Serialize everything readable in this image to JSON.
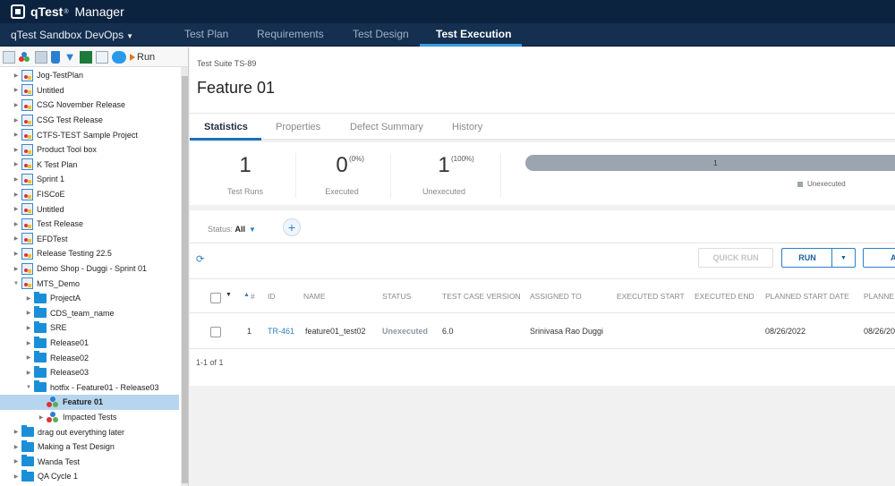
{
  "header": {
    "brand": "qTest",
    "brand_sup": "®",
    "app_name": "Manager"
  },
  "nav": {
    "project": "qTest Sandbox DevOps",
    "tabs": [
      {
        "label": "Test Plan",
        "active": false
      },
      {
        "label": "Requirements",
        "active": false
      },
      {
        "label": "Test Design",
        "active": false
      },
      {
        "label": "Test Execution",
        "active": true
      }
    ]
  },
  "sidebar": {
    "toolbar": {
      "icons": [
        "release-icon",
        "new-suite-icon",
        "new-module-icon",
        "delete-icon",
        "filter-icon",
        "export-excel-icon",
        "import-icon",
        "toggle-icon"
      ],
      "run_label": "Run"
    },
    "tree": [
      {
        "label": "Jog-TestPlan",
        "type": "plan",
        "level": 1,
        "expand": "closed"
      },
      {
        "label": "Untitled",
        "type": "plan",
        "level": 1,
        "expand": "closed"
      },
      {
        "label": "CSG November Release",
        "type": "plan",
        "level": 1,
        "expand": "closed"
      },
      {
        "label": "CSG Test Release",
        "type": "plan",
        "level": 1,
        "expand": "closed"
      },
      {
        "label": "CTFS-TEST Sample Project",
        "type": "plan",
        "level": 1,
        "expand": "closed"
      },
      {
        "label": "Product Tool box",
        "type": "plan",
        "level": 1,
        "expand": "closed"
      },
      {
        "label": "K Test Plan",
        "type": "plan",
        "level": 1,
        "expand": "closed"
      },
      {
        "label": "Sprint 1",
        "type": "plan",
        "level": 1,
        "expand": "closed"
      },
      {
        "label": "FISCoE",
        "type": "plan",
        "level": 1,
        "expand": "closed"
      },
      {
        "label": "Untitled",
        "type": "plan",
        "level": 1,
        "expand": "closed"
      },
      {
        "label": "Test Release",
        "type": "plan",
        "level": 1,
        "expand": "closed"
      },
      {
        "label": "EFDTest",
        "type": "plan",
        "level": 1,
        "expand": "closed"
      },
      {
        "label": "Release Testing 22.5",
        "type": "plan",
        "level": 1,
        "expand": "closed"
      },
      {
        "label": "Demo Shop - Duggi - Sprint 01",
        "type": "plan",
        "level": 1,
        "expand": "closed"
      },
      {
        "label": "MTS_Demo",
        "type": "plan",
        "level": 1,
        "expand": "open"
      },
      {
        "label": "ProjectA",
        "type": "folder",
        "level": 2,
        "expand": "closed"
      },
      {
        "label": "CDS_team_name",
        "type": "folder",
        "level": 2,
        "expand": "closed"
      },
      {
        "label": "SRE",
        "type": "folder",
        "level": 2,
        "expand": "closed"
      },
      {
        "label": "Release01",
        "type": "folder",
        "level": 2,
        "expand": "closed"
      },
      {
        "label": "Release02",
        "type": "folder",
        "level": 2,
        "expand": "closed"
      },
      {
        "label": "Release03",
        "type": "folder",
        "level": 2,
        "expand": "closed"
      },
      {
        "label": "hotfix - Feature01 - Release03",
        "type": "folder",
        "level": 2,
        "expand": "open"
      },
      {
        "label": "Feature 01",
        "type": "suite",
        "level": 3,
        "expand": "none",
        "selected": true
      },
      {
        "label": "Impacted Tests",
        "type": "suite",
        "level": 3,
        "expand": "closed"
      },
      {
        "label": "drag out everything later",
        "type": "folder",
        "level": 1,
        "expand": "closed"
      },
      {
        "label": "Making a Test Design",
        "type": "folder",
        "level": 1,
        "expand": "closed"
      },
      {
        "label": "Wanda Test",
        "type": "folder",
        "level": 1,
        "expand": "closed"
      },
      {
        "label": "QA Cycle 1",
        "type": "folder",
        "level": 1,
        "expand": "closed"
      }
    ]
  },
  "main": {
    "suite_label": "Test Suite TS-89",
    "title": "Feature 01",
    "tabs": [
      {
        "label": "Statistics",
        "active": true
      },
      {
        "label": "Properties",
        "active": false
      },
      {
        "label": "Defect Summary",
        "active": false
      },
      {
        "label": "History",
        "active": false
      }
    ],
    "stats": [
      {
        "value": "1",
        "pct": "",
        "label": "Test Runs"
      },
      {
        "value": "0",
        "pct": "(0%)",
        "label": "Executed"
      },
      {
        "value": "1",
        "pct": "(100%)",
        "label": "Unexecuted"
      }
    ],
    "progress": {
      "segment_value": "1",
      "unexecuted_fraction": 1.0,
      "legend": "Unexecuted",
      "color": "#9aa5af"
    },
    "filter": {
      "label": "Status:",
      "value": "All"
    },
    "buttons": {
      "quick_run": "QUICK RUN",
      "run": "RUN",
      "partial_third": "A"
    },
    "table": {
      "columns": [
        "#",
        "ID",
        "NAME",
        "STATUS",
        "TEST CASE VERSION",
        "ASSIGNED TO",
        "EXECUTED START",
        "EXECUTED END",
        "PLANNED START DATE",
        "PLANNE"
      ],
      "rows": [
        {
          "num": "1",
          "id": "TR-461",
          "name": "feature01_test02",
          "status": "Unexecuted",
          "version": "6.0",
          "assigned": "Srinivasa Rao Duggi",
          "exec_start": "",
          "exec_end": "",
          "planned_start": "08/26/2022",
          "planned_end": "08/26/20"
        }
      ]
    },
    "pager": "1-1 of 1"
  },
  "colors": {
    "nav_bg": "#0c2340",
    "accent": "#3b99e0",
    "link": "#2e7fc2"
  }
}
